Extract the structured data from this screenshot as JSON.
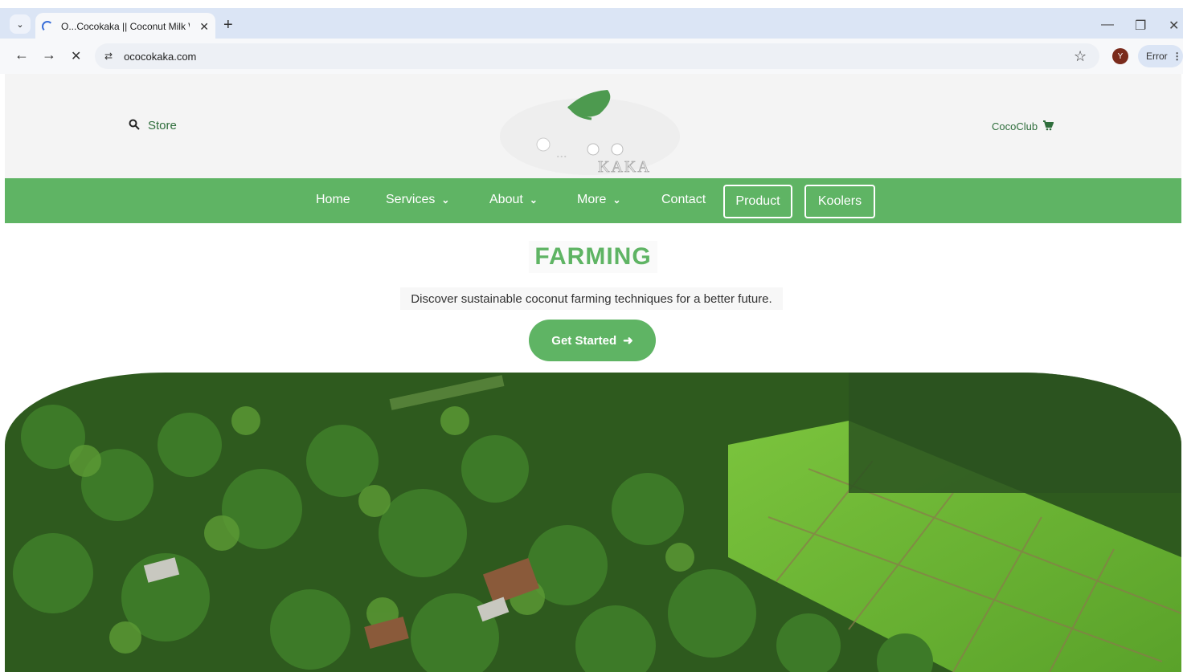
{
  "browser": {
    "tab_title": "O...Cocokaka || Coconut Milk W",
    "url": "ococokaka.com",
    "profile_initial": "Y",
    "error_label": "Error"
  },
  "header": {
    "store_label": "Store",
    "cococlub_label": "CocoClub",
    "logo_text": "KAKA"
  },
  "nav": {
    "home": "Home",
    "services": "Services",
    "about": "About",
    "more": "More",
    "contact": "Contact",
    "product": "Product",
    "koolers": "Koolers"
  },
  "hero": {
    "title": "FARMING",
    "subtitle": "Discover sustainable coconut farming techniques for a better future.",
    "cta_label": "Get Started"
  },
  "colors": {
    "brand_green": "#5fb464",
    "header_bg": "#f4f4f4",
    "chrome_tab_bg": "#dbe5f5"
  },
  "icons": {
    "search": "search-icon",
    "cart": "cart-icon",
    "arrow": "arrow-right-icon",
    "chevron": "chevron-down-icon"
  }
}
